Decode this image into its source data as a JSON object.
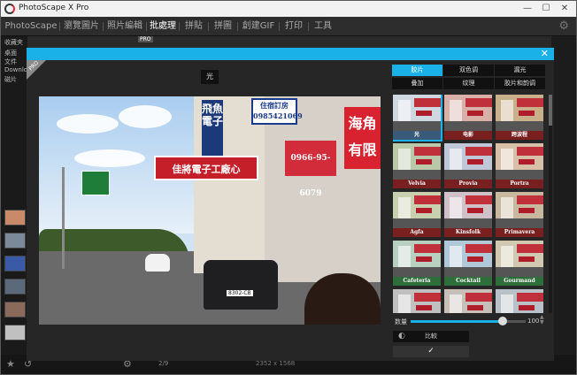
{
  "window": {
    "title": "PhotoScape X Pro",
    "minimize_glyph": "—",
    "maximize_glyph": "☐",
    "close_glyph": "✕"
  },
  "menu": {
    "items": [
      "PhotoScape X",
      "瀏覽圖片",
      "照片編輯",
      "批處理",
      "拼貼",
      "拼圖",
      "創建GIF",
      "打印",
      "工具"
    ],
    "active_index": 3,
    "settings_icon": "gear-icon"
  },
  "left_panel": {
    "folders": [
      "收藏夹",
      "桌面",
      "文件",
      "Downloads",
      "磁片"
    ]
  },
  "behind_header": {
    "pro_badge": "PRO"
  },
  "status": {
    "image_size": "2352 x 1568",
    "count": "2/9"
  },
  "modal": {
    "close_glyph": "✕",
    "pro_badge": "PRO",
    "preview_caption": "光"
  },
  "photo_signs": {
    "vertical_sign": "飛魚電子",
    "order_sign_title": "住宿訂房",
    "order_sign_phone": "0985421069",
    "red_banner": "佳將電子工廠心",
    "big_red_sign": "海角有限",
    "tile_phone": "0966-95-6079",
    "plate": "8302-CB"
  },
  "filter_panel": {
    "tabs": [
      [
        "胶片",
        "双色调",
        "漏光"
      ],
      [
        "叠加",
        "纹理",
        "胶片和韵调"
      ]
    ],
    "active_tab": "胶片",
    "filters": [
      "光",
      "电影",
      "跨波程",
      "Velvia",
      "Provia",
      "Portra",
      "Agfa",
      "Kinsfolk",
      "Primavera",
      "Cafeteria",
      "Cocktail",
      "Gourmand",
      "",
      "",
      ""
    ],
    "filter_label_colors": [
      "#3a5a7a",
      "#7a1f1f",
      "#7a1f1f",
      "#7a1f1f",
      "#7a1f1f",
      "#7a1f1f",
      "#7a1f1f",
      "#7a1f1f",
      "#7a1f1f",
      "#2e6e3a",
      "#2e6e3a",
      "#2e6e3a",
      "#444444",
      "#444444",
      "#444444"
    ],
    "selected_index": 0,
    "amount_label": "数量",
    "amount_value": "100",
    "amount_fraction": 0.8,
    "compare_label": "比較",
    "ok_glyph": "✓",
    "accent_color": "#1ab0e8"
  }
}
